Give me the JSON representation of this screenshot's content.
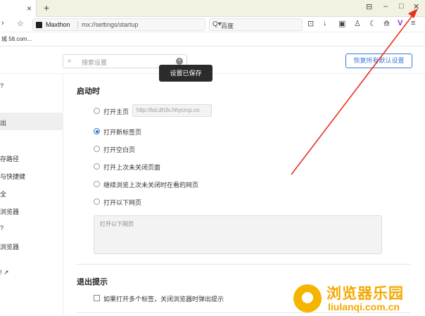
{
  "browser": {
    "tab_close_icon": "×",
    "new_tab_icon": "+",
    "window": {
      "sidebar_icon": "⊟",
      "minimize_icon": "–",
      "maximize_icon": "□",
      "close_icon": "✕"
    },
    "nav": {
      "back_icon": "›",
      "bookmark_icon": "☆"
    },
    "address": {
      "site_name": "Maxthon",
      "url": "mx://settings/startup"
    },
    "search": {
      "icon": "Q▾",
      "engine": "百度"
    },
    "tools": [
      "⊡",
      "↓",
      "▣",
      "♙",
      "☾",
      "⟰",
      "V",
      "≡"
    ],
    "bookmark": "城 58.com..."
  },
  "settings": {
    "search_placeholder": "搜索设置",
    "search_icon": "⌕",
    "clear_icon": "×",
    "restore_button": "恢复所有默认设置",
    "toast": "设置已保存"
  },
  "sidebar": {
    "items": [
      "?",
      "出",
      "存路径",
      "与快捷键",
      "全",
      "浏览器",
      "?",
      "浏览器",
      "! ↗"
    ]
  },
  "startup": {
    "title": "启动时",
    "options": [
      {
        "label": "打开主页",
        "checked": false
      },
      {
        "label": "打开新标签页",
        "checked": true
      },
      {
        "label": "打开空白页",
        "checked": false
      },
      {
        "label": "打开上次未关闭页面",
        "checked": false
      },
      {
        "label": "继续浏览上次未关闭时在看的网页",
        "checked": false
      },
      {
        "label": "打开以下网页",
        "checked": false
      }
    ],
    "home_url": "http://bd.dh3x.hhycrcp.co",
    "pages_placeholder": "打开以下网页"
  },
  "exit": {
    "title": "退出提示",
    "checkbox_label": "如果打开多个标签，关闭浏览器时弹出提示",
    "checked": false
  },
  "watermark": {
    "title": "浏览器乐园",
    "subtitle": "liulanqi.com.cn"
  },
  "colors": {
    "accent": "#2f6fd0",
    "arrow": "#e8321e",
    "watermark": "#f5a800"
  }
}
